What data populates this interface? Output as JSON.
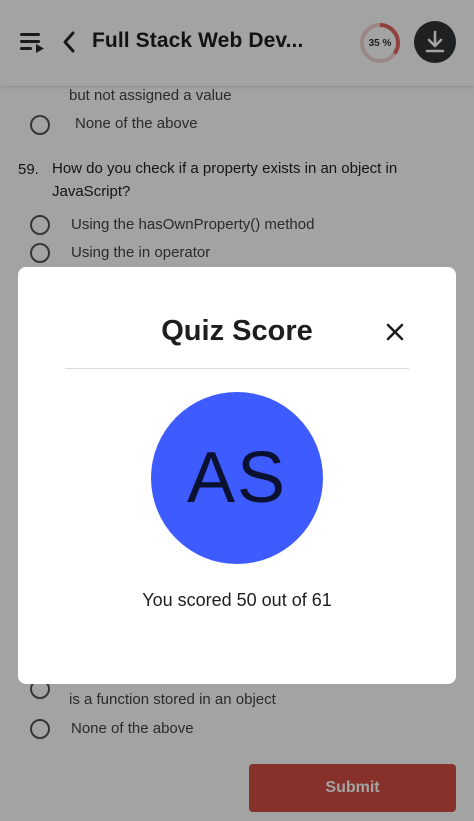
{
  "header": {
    "title": "Full Stack Web Dev...",
    "progress": {
      "label": "35 %",
      "fraction": 0.35,
      "color": "#e0675d"
    }
  },
  "content": {
    "prev_option_tail": "but not assigned a value",
    "prev_option_none": "None of the above",
    "question": {
      "number": "59.",
      "text_line1": "How do you check if a property exists in an object in",
      "text_line2": "JavaScript?",
      "options": [
        "Using the hasOwnProperty() method",
        "Using the in operator"
      ]
    },
    "next_option_tail": "is a function stored in an object",
    "next_option_none": "None of the above",
    "submit_label": "Submit"
  },
  "modal": {
    "title": "Quiz Score",
    "avatar_initials": "AS",
    "score_text": "You scored 50 out of 61",
    "avatar_color": "#3d5bff"
  }
}
